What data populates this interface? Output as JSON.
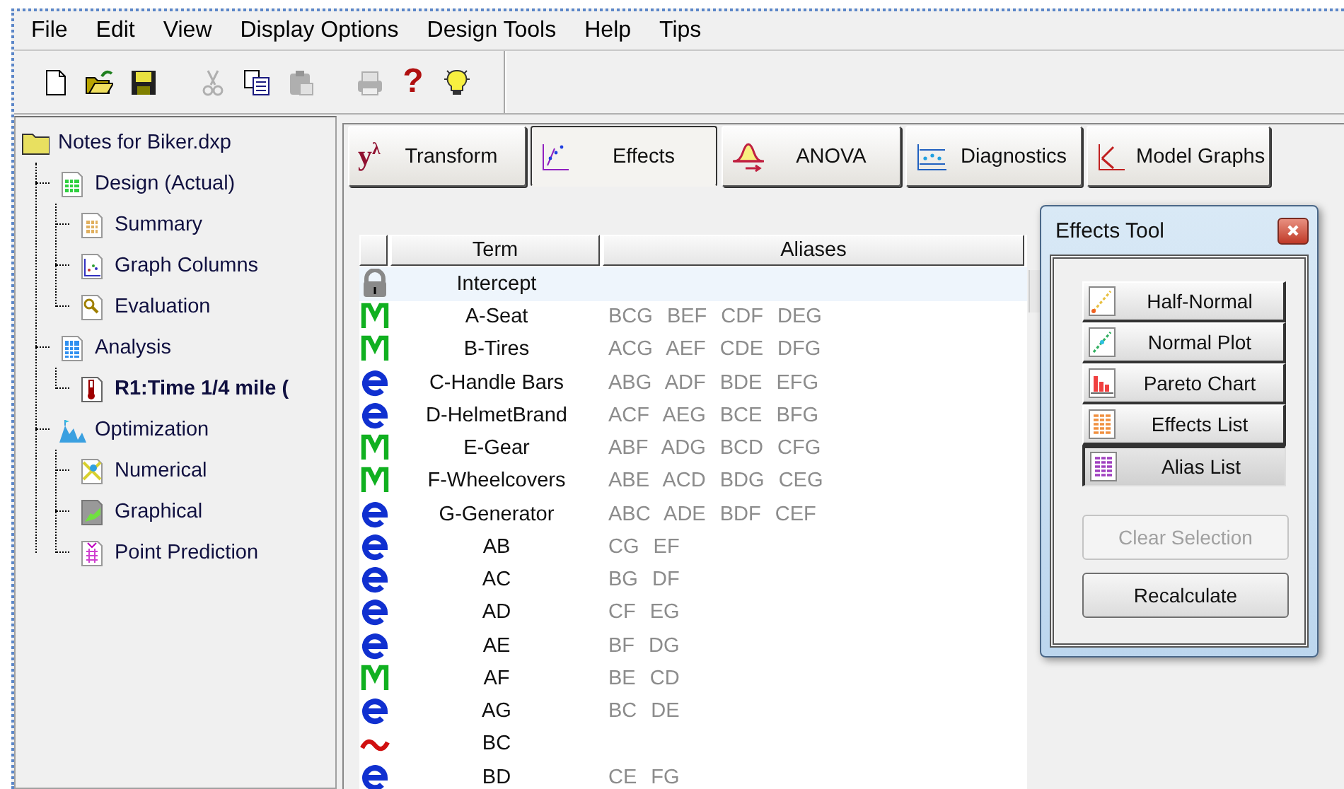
{
  "menu": [
    "File",
    "Edit",
    "View",
    "Display Options",
    "Design Tools",
    "Help",
    "Tips"
  ],
  "toolbar": [
    {
      "kind": "new",
      "disabled": false
    },
    {
      "kind": "open",
      "disabled": false
    },
    {
      "kind": "save",
      "disabled": false
    },
    {
      "kind": "cut",
      "disabled": true
    },
    {
      "kind": "copy",
      "disabled": false
    },
    {
      "kind": "paste",
      "disabled": true
    },
    {
      "kind": "print",
      "disabled": true
    },
    {
      "kind": "help",
      "label": "?",
      "disabled": false
    },
    {
      "kind": "tip",
      "disabled": false
    }
  ],
  "tree": {
    "label": "Notes for Biker.dxp",
    "kind": "folder",
    "bold": false,
    "children": [
      {
        "label": "Design (Actual)",
        "kind": "grid",
        "bold": false,
        "children": [
          {
            "label": "Summary",
            "kind": "table",
            "bold": false
          },
          {
            "label": "Graph Columns",
            "kind": "scatter",
            "bold": false
          },
          {
            "label": "Evaluation",
            "kind": "magnifier",
            "bold": false
          }
        ]
      },
      {
        "label": "Analysis",
        "kind": "calculator",
        "bold": false,
        "children": [
          {
            "label": "R1:Time 1/4 mile (",
            "kind": "thermometer",
            "bold": true
          }
        ]
      },
      {
        "label": "Optimization",
        "kind": "mountain",
        "bold": false,
        "children": [
          {
            "label": "Numerical",
            "kind": "numerical",
            "bold": false
          },
          {
            "label": "Graphical",
            "kind": "graphical",
            "bold": false
          },
          {
            "label": "Point Prediction",
            "kind": "prediction",
            "bold": false
          }
        ]
      }
    ]
  },
  "tabs": [
    {
      "label": "Transform",
      "kind": "transform",
      "icon_text": "y$^{λ}$",
      "selected": false
    },
    {
      "label": "Effects",
      "kind": "effects",
      "selected": true
    },
    {
      "label": "ANOVA",
      "kind": "anova",
      "selected": false
    },
    {
      "label": "Diagnostics",
      "kind": "diagnostics",
      "selected": false
    },
    {
      "label": "Model Graphs",
      "kind": "graphs",
      "selected": false
    }
  ],
  "table": {
    "columns": [
      "Term",
      "Aliases"
    ],
    "rows": [
      {
        "kind": "locked",
        "term": "Intercept",
        "selected": true
      },
      {
        "kind": "model",
        "term": "A-Seat",
        "aliases": "BCG BEF CDF DEG",
        "selected": false
      },
      {
        "kind": "model",
        "term": "B-Tires",
        "aliases": "ACG AEF CDE DFG",
        "selected": false
      },
      {
        "kind": "error",
        "term": "C-Handle Bars",
        "aliases": "ABG ADF BDE EFG",
        "selected": false
      },
      {
        "kind": "error",
        "term": "D-HelmetBrand",
        "aliases": "ACF AEG BCE BFG",
        "selected": false
      },
      {
        "kind": "model",
        "term": "E-Gear",
        "aliases": "ABF ADG BCD CFG",
        "selected": false
      },
      {
        "kind": "model",
        "term": "F-Wheelcovers",
        "aliases": "ABE ACD BDG CEG",
        "selected": false
      },
      {
        "kind": "error",
        "term": "G-Generator",
        "aliases": "ABC ADE BDF CEF",
        "selected": false
      },
      {
        "kind": "error",
        "term": "AB",
        "aliases": "CG EF",
        "selected": false
      },
      {
        "kind": "error",
        "term": "AC",
        "aliases": "BG DF",
        "selected": false
      },
      {
        "kind": "error",
        "term": "AD",
        "aliases": "CF EG",
        "selected": false
      },
      {
        "kind": "error",
        "term": "AE",
        "aliases": "BF DG",
        "selected": false
      },
      {
        "kind": "model",
        "term": "AF",
        "aliases": "BE CD",
        "selected": false
      },
      {
        "kind": "error",
        "term": "AG",
        "aliases": "BC DE",
        "selected": false
      },
      {
        "kind": "ignored",
        "term": "BC",
        "selected": false
      },
      {
        "kind": "error",
        "term": "BD",
        "aliases": "CE FG",
        "selected": false
      }
    ]
  },
  "effects_tool": {
    "title": "Effects Tool",
    "views": [
      {
        "label": "Half-Normal",
        "kind": "halfnormal",
        "selected": false
      },
      {
        "label": "Normal Plot",
        "kind": "normal",
        "selected": false
      },
      {
        "label": "Pareto Chart",
        "kind": "pareto",
        "selected": false
      },
      {
        "label": "Effects List",
        "kind": "effectslist",
        "selected": false
      },
      {
        "label": "Alias List",
        "kind": "aliaslist",
        "selected": true
      }
    ],
    "actions": [
      {
        "label": "Clear Selection",
        "disabled": true
      },
      {
        "label": "Recalculate",
        "disabled": false
      }
    ]
  }
}
